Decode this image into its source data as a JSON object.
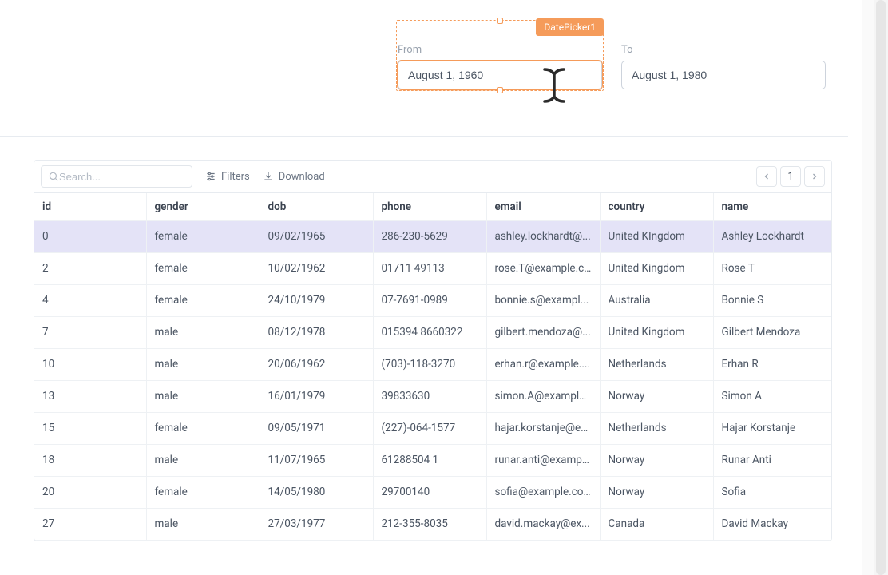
{
  "widget_tag": "DatePicker1",
  "datepickers": {
    "from": {
      "label": "From",
      "value": "August 1, 1960"
    },
    "to": {
      "label": "To",
      "value": "August 1, 1980"
    }
  },
  "toolbar": {
    "search_placeholder": "Search...",
    "filters_label": "Filters",
    "download_label": "Download",
    "page_number": "1"
  },
  "table": {
    "columns": [
      "id",
      "gender",
      "dob",
      "phone",
      "email",
      "country",
      "name"
    ],
    "rows": [
      {
        "id": "0",
        "gender": "female",
        "dob": "09/02/1965",
        "phone": "286-230-5629",
        "email": "ashley.lockhardt@...",
        "country": "United KIngdom",
        "name": "Ashley Lockhardt",
        "selected": true
      },
      {
        "id": "2",
        "gender": "female",
        "dob": "10/02/1962",
        "phone": "01711 49113",
        "email": "rose.T@example.c...",
        "country": "United Kingdom",
        "name": "Rose T"
      },
      {
        "id": "4",
        "gender": "female",
        "dob": "24/10/1979",
        "phone": "07-7691-0989",
        "email": "bonnie.s@exampl...",
        "country": "Australia",
        "name": "Bonnie S"
      },
      {
        "id": "7",
        "gender": "male",
        "dob": "08/12/1978",
        "phone": "015394 8660322",
        "email": "gilbert.mendoza@...",
        "country": "United Kingdom",
        "name": "Gilbert Mendoza"
      },
      {
        "id": "10",
        "gender": "male",
        "dob": "20/06/1962",
        "phone": "(703)-118-3270",
        "email": "erhan.r@example....",
        "country": "Netherlands",
        "name": "Erhan R"
      },
      {
        "id": "13",
        "gender": "male",
        "dob": "16/01/1979",
        "phone": "39833630",
        "email": "simon.A@example...",
        "country": "Norway",
        "name": "Simon A"
      },
      {
        "id": "15",
        "gender": "female",
        "dob": "09/05/1971",
        "phone": "(227)-064-1577",
        "email": "hajar.korstanje@ex...",
        "country": "Netherlands",
        "name": "Hajar Korstanje"
      },
      {
        "id": "18",
        "gender": "male",
        "dob": "11/07/1965",
        "phone": "61288504 1",
        "email": "runar.anti@exampl...",
        "country": "Norway",
        "name": "Runar Anti"
      },
      {
        "id": "20",
        "gender": "female",
        "dob": "14/05/1980",
        "phone": "29700140",
        "email": "sofia@example.com",
        "country": "Norway",
        "name": "Sofia"
      },
      {
        "id": "27",
        "gender": "male",
        "dob": "27/03/1977",
        "phone": "212-355-8035",
        "email": "david.mackay@ex...",
        "country": "Canada",
        "name": "David Mackay"
      }
    ]
  }
}
